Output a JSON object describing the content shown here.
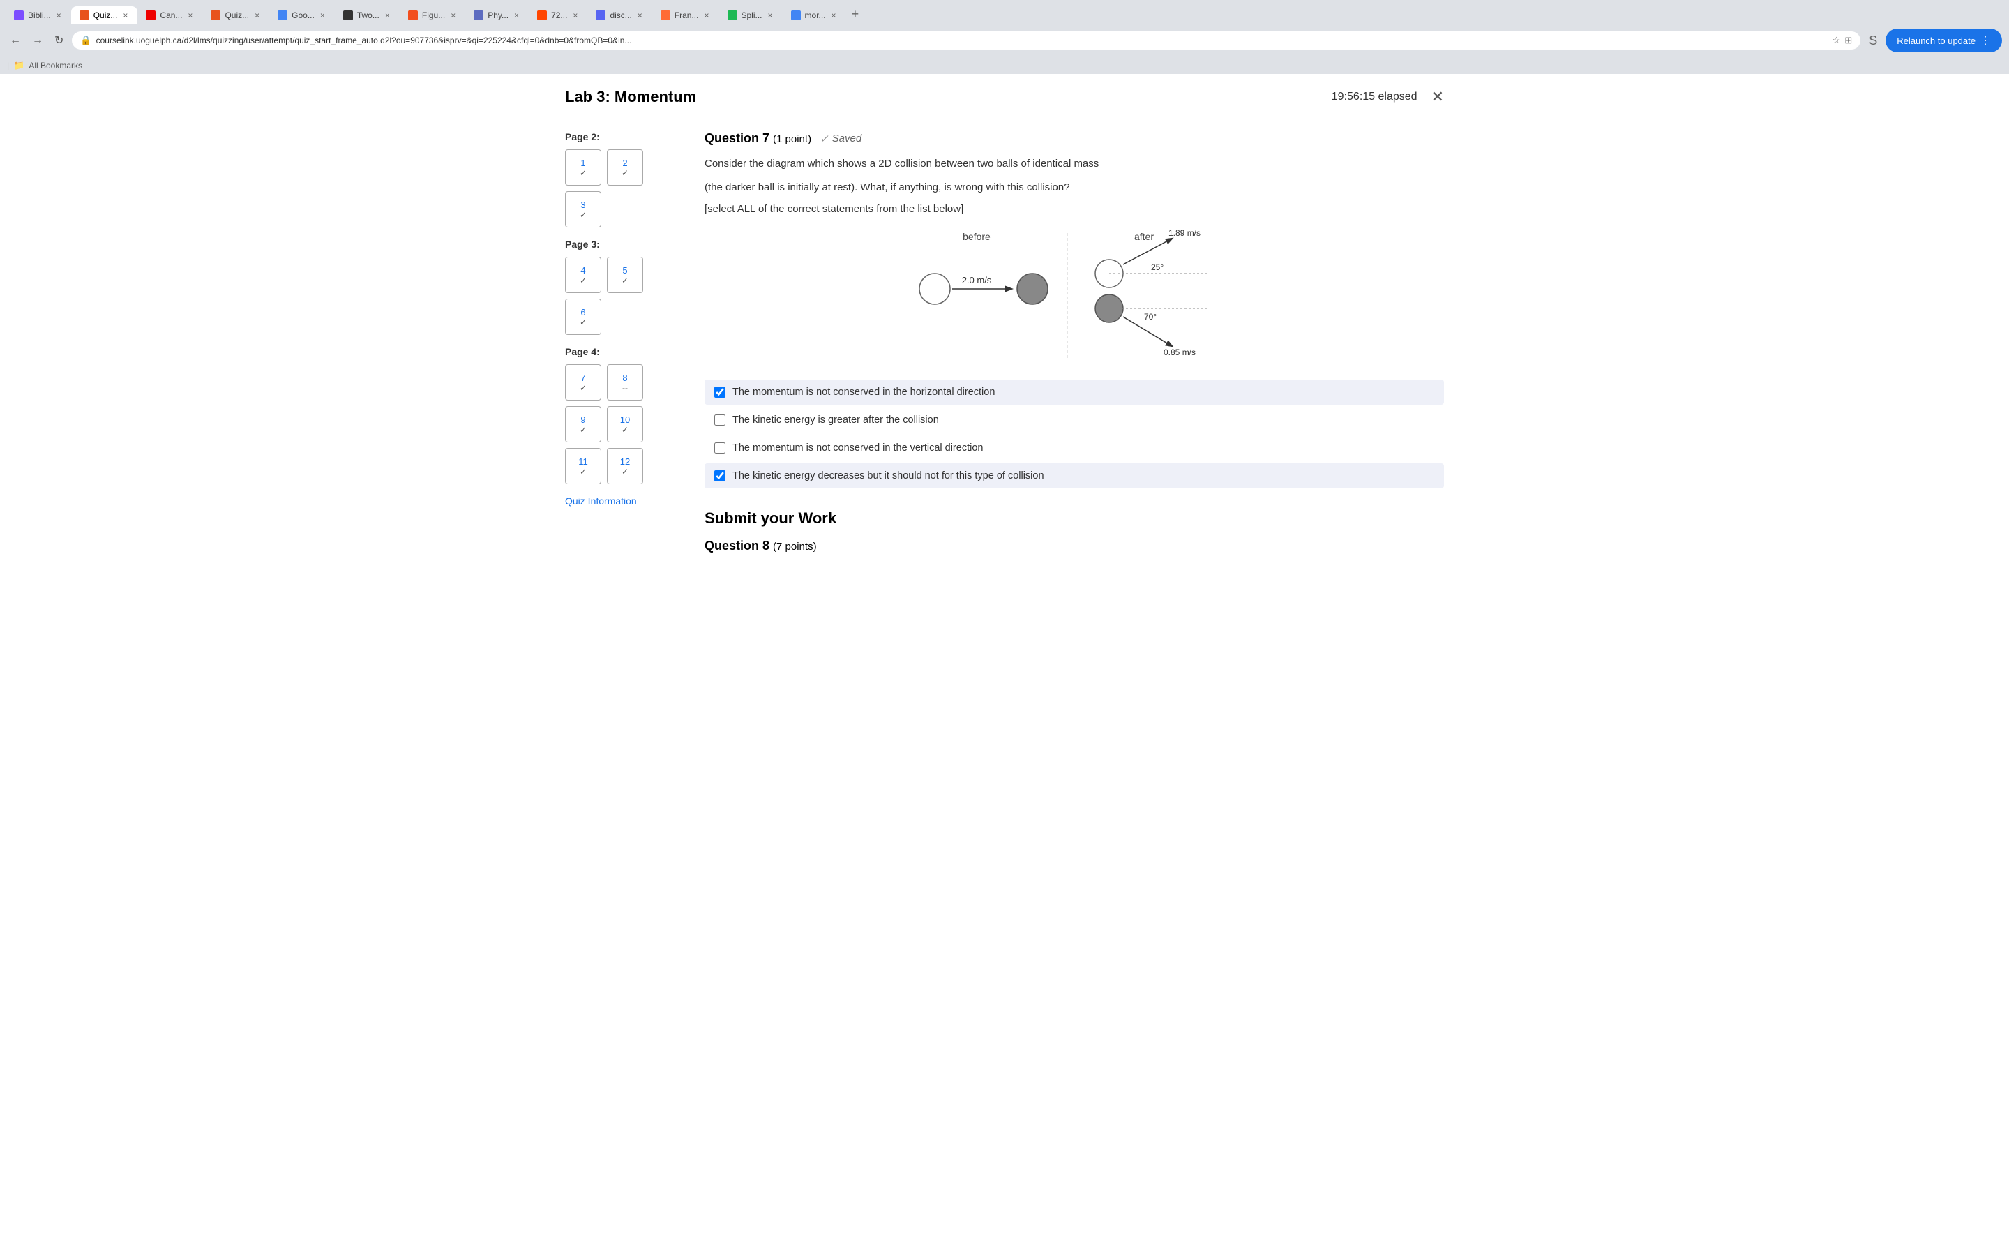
{
  "browser": {
    "address": "courselink.uoguelph.ca/d2l/lms/quizzing/user/attempt/quiz_start_frame_auto.d2l?ou=907736&isprv=&qi=225224&cfql=0&dnb=0&fromQB=0&in...",
    "relaunch_label": "Relaunch to update",
    "bookmarks_label": "All Bookmarks",
    "tabs": [
      {
        "id": "biblio",
        "label": "Bibli...",
        "favicon_class": "biblio",
        "active": false
      },
      {
        "id": "d2l-quiz",
        "label": "Quiz...",
        "favicon_class": "d2l",
        "active": true
      },
      {
        "id": "canvas",
        "label": "Can...",
        "favicon_class": "canvas",
        "active": false
      },
      {
        "id": "d2l-quiz2",
        "label": "Quiz...",
        "favicon_class": "d2l",
        "active": false
      },
      {
        "id": "google",
        "label": "Goo...",
        "favicon_class": "google",
        "active": false
      },
      {
        "id": "two",
        "label": "Two...",
        "favicon_class": "two",
        "active": false
      },
      {
        "id": "figma",
        "label": "Figu...",
        "favicon_class": "figma",
        "active": false
      },
      {
        "id": "phy",
        "label": "Phy...",
        "favicon_class": "phy",
        "active": false
      },
      {
        "id": "reddit",
        "label": "72...",
        "favicon_class": "reddit",
        "active": false
      },
      {
        "id": "discord",
        "label": "disc...",
        "favicon_class": "discord",
        "active": false
      },
      {
        "id": "franz",
        "label": "Fran...",
        "favicon_class": "franz",
        "active": false
      },
      {
        "id": "split",
        "label": "Spli...",
        "favicon_class": "split",
        "active": false
      },
      {
        "id": "more",
        "label": "mor...",
        "favicon_class": "more",
        "active": false
      }
    ]
  },
  "quiz": {
    "title": "Lab 3: Momentum",
    "timer": "19:56:15 elapsed",
    "sidebar": {
      "page2_label": "Page 2:",
      "page3_label": "Page 3:",
      "page4_label": "Page 4:",
      "questions": [
        {
          "num": "1",
          "status": "✓"
        },
        {
          "num": "2",
          "status": "✓"
        },
        {
          "num": "3",
          "status": "✓"
        },
        {
          "num": "4",
          "status": "✓"
        },
        {
          "num": "5",
          "status": "✓"
        },
        {
          "num": "6",
          "status": "✓"
        },
        {
          "num": "7",
          "status": "✓"
        },
        {
          "num": "8",
          "status": "--"
        },
        {
          "num": "9",
          "status": "✓"
        },
        {
          "num": "10",
          "status": "✓"
        },
        {
          "num": "11",
          "status": "✓"
        },
        {
          "num": "12",
          "status": "✓"
        }
      ],
      "quiz_info_label": "Quiz Information"
    },
    "question7": {
      "label": "Question 7",
      "points": "(1 point)",
      "saved_label": "Saved",
      "text_line1": "Consider the diagram which shows a 2D collision between two balls of identical mass",
      "text_line2": "(the darker ball is initially at rest).  What, if anything, is wrong with this collision?",
      "instruction": "[select ALL of the correct statements from the list below]",
      "before_label": "before",
      "after_label": "after",
      "diagram": {
        "initial_velocity": "2.0 m/s",
        "v1_after": "1.89 m/s",
        "v2_after": "0.85 m/s",
        "angle1": "25°",
        "angle2": "70°"
      },
      "options": [
        {
          "id": "opt1",
          "text": "The momentum is not conserved in the horizontal direction",
          "checked": true
        },
        {
          "id": "opt2",
          "text": "The kinetic energy is greater after the collision",
          "checked": false
        },
        {
          "id": "opt3",
          "text": "The momentum is not conserved in the vertical direction",
          "checked": false
        },
        {
          "id": "opt4",
          "text": "The kinetic energy decreases but it should not for this type of collision",
          "checked": true
        }
      ]
    },
    "submit_section": {
      "title": "Submit your Work"
    },
    "question8": {
      "label": "Question 8",
      "points": "(7 points)"
    }
  }
}
